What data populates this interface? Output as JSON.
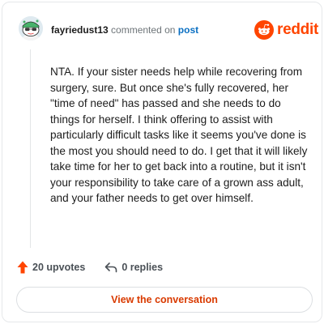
{
  "header": {
    "username": "fayriedust13",
    "action_text": "commented on",
    "post_link": "post",
    "brand_name": "reddit"
  },
  "comment": {
    "text": "NTA. If your sister needs help while recovering from surgery, sure. But once she's fully recovered, her \"time of need\" has passed and she needs to do things for herself. I think offering to assist with particularly difficult tasks like it seems you've done is the most you should need to do. I get that it will likely take time for her to get back into a routine, but it isn't your responsibility to take care of a grown ass adult, and your father needs to get over himself."
  },
  "actions": {
    "upvotes": "20 upvotes",
    "replies": "0 replies",
    "upvote_icon": "upvote-arrow-icon",
    "reply_icon": "reply-arrow-icon"
  },
  "footer": {
    "button_label": "View the conversation"
  },
  "colors": {
    "brand": "#ff4500",
    "link": "#0a6fc2",
    "button_text": "#d93a00",
    "upvote": "#ff4500"
  }
}
